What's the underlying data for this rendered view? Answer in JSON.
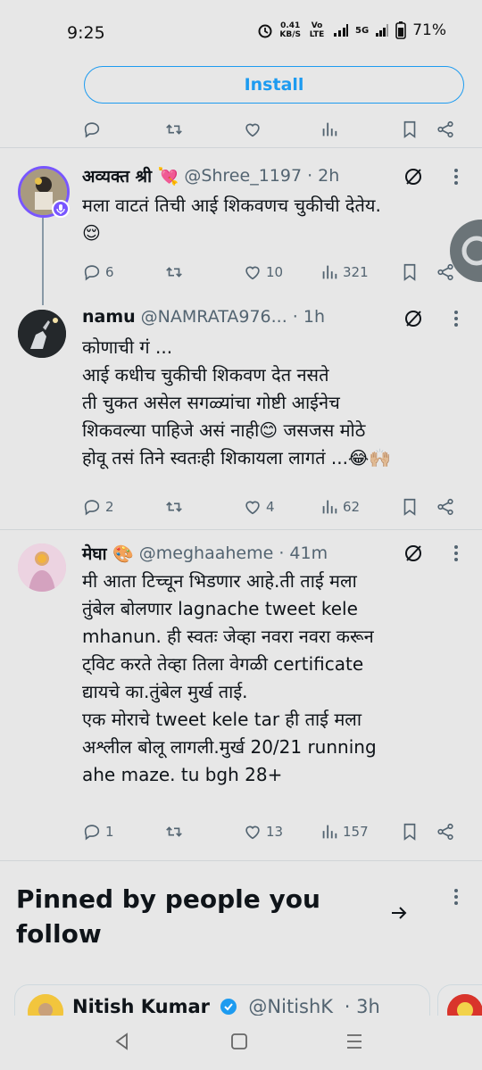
{
  "status": {
    "time": "9:25",
    "net_speed": "0.41",
    "net_unit": "KB/S",
    "volte": "Vo LTE",
    "net_5g": "5G",
    "battery": "71%"
  },
  "install_label": "Install",
  "tweets": [
    {
      "name": "अव्यक्त श्री 💘",
      "handle": "@Shree_1197 · 2h",
      "text": "मला वाटतं तिची आई शिकवणच चुकीची देतेय.\n😌",
      "replies": "6",
      "retweets": "",
      "likes": "10",
      "views": "321"
    },
    {
      "name": "namu",
      "handle": "@NAMRATA976...  · 1h",
      "text": "कोणाची गं ...\nआई कधीच चुकीची शिकवण देत नसते\nती चुकत असेल सगळ्यांचा गोष्टी आईनेच\nशिकवल्या पाहिजे असं नाही😊 जसजस मोठे\nहोवू तसं तिने स्वतःही शिकायला लागतं ...😂🙌🏼",
      "replies": "2",
      "retweets": "",
      "likes": "4",
      "views": "62"
    },
    {
      "name": "मेघा 🎨",
      "handle": "@meghaaheme · 41m",
      "text": "मी आता टिच्चून भिडणार आहे.ती ताई मला\nतुंबेल बोलणार lagnache tweet kele\nmhanun. ही स्वतः जेव्हा नवरा नवरा करून\nट्विट करते तेव्हा तिला वेगळी certificate\nद्यायचे का.तुंबेल मुर्ख ताई.\nएक मोराचे tweet kele tar ही ताई मला\nअश्लील बोलू लागली.मुर्ख 20/21 running\nahe maze. tu bgh 28+",
      "replies": "1",
      "retweets": "",
      "likes": "13",
      "views": "157"
    }
  ],
  "pinned": {
    "title": "Pinned by people you follow",
    "card_name": "Nitish Kumar",
    "card_handle": "@NitishK",
    "card_time": "· 3h"
  },
  "colors": {
    "accent": "#1d9bf0",
    "background": "#e7e7e7",
    "muted": "#536471"
  }
}
